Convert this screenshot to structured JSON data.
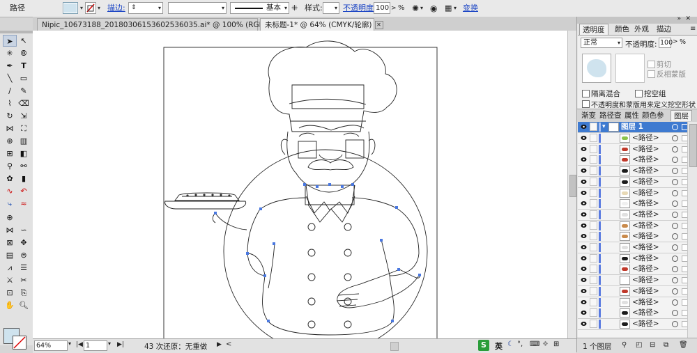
{
  "control_bar": {
    "object_type": "路径",
    "stroke_label": "描边:",
    "stroke_weight_icon": "stepper-icon",
    "brush_name": "基本",
    "style_label": "样式:",
    "opacity_label": "不透明度",
    "opacity_value": "100",
    "opacity_unit": "%",
    "transform_label": "变换",
    "fill_color": "#cfe3ee"
  },
  "doc_tabs": [
    {
      "label": "Nipic_10673188_20180306153602536035.ai* @ 100% (RGB/预览)",
      "active": false
    },
    {
      "label": "未标题-1* @ 64% (CMYK/轮廓)",
      "active": true
    }
  ],
  "status_bar": {
    "zoom": "64%",
    "artboard": "1",
    "status_text": "43 次还原：无重做",
    "ime_label": "英"
  },
  "transparency_panel": {
    "tabs": [
      "透明度",
      "颜色",
      "外观",
      "描边"
    ],
    "blend_mode": "正常",
    "opacity_label": "不透明度:",
    "opacity_value": "100",
    "opacity_unit": "%",
    "clip_label": "剪切",
    "invert_mask_label": "反相蒙版",
    "isolate_blend_label": "隔离混合",
    "knockout_label": "挖空组",
    "opacity_mask_label": "不透明度和蒙版用来定义挖空形状",
    "preview_color": "#cfe3ee"
  },
  "layers_panel": {
    "tabs": [
      "渐变",
      "路径查",
      "属性",
      "颜色参",
      "图层"
    ],
    "layer_name": "图层 1",
    "items": [
      "<路径>",
      "<路径>",
      "<路径>",
      "<路径>",
      "<路径>",
      "<路径>",
      "<路径>",
      "<路径>",
      "<路径>",
      "<路径>",
      "<路径>",
      "<路径>",
      "<路径>",
      "<路径>",
      "<路径>",
      "<路径>",
      "<路径>",
      "<路径>"
    ],
    "footer_label": "1 个图层"
  },
  "toolbar": {
    "fill_color": "#cfe3ee"
  }
}
